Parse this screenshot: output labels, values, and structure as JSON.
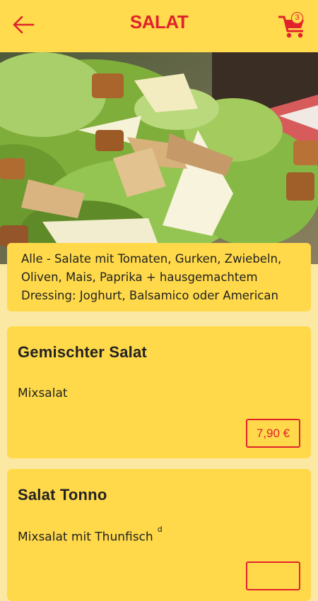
{
  "header": {
    "title": "SALAT",
    "back_icon": "arrow-left-icon",
    "cart_icon": "shopping-cart-icon",
    "cart_count": "3"
  },
  "hero": {
    "image": "salad-photo"
  },
  "info": {
    "lines": [
      "Alle - Salate mit Tomaten, Gurken, Zwiebeln,",
      "Oliven, Mais, Paprika + hausgemachtem",
      "Dressing: Joghurt, Balsamico oder American"
    ]
  },
  "items": [
    {
      "name": "Gemischter Salat",
      "description": "Mixsalat",
      "note": "",
      "price": "7,90 €"
    },
    {
      "name": "Salat Tonno",
      "description": "Mixsalat mit Thunfisch",
      "note": "d",
      "price": ""
    }
  ],
  "colors": {
    "accent": "#e0232b",
    "header": "#ffdb4d",
    "card": "#ffd94a",
    "background": "#fbe9a3"
  }
}
